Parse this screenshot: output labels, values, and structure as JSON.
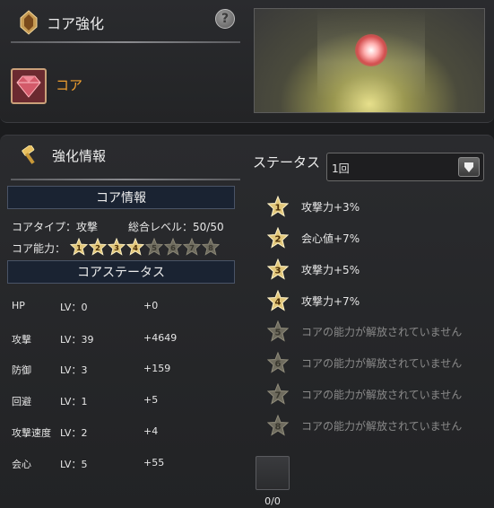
{
  "header": {
    "title": "コア強化",
    "help_symbol": "?",
    "core_label": "コア"
  },
  "enhance": {
    "section_title": "強化情報",
    "core_info_title": "コア情報",
    "core_type": "コアタイプ：攻撃",
    "total_level": "総合レベル：50/50",
    "core_ability_label": "コア能力：",
    "ability_stars": [
      {
        "n": "1",
        "unlocked": true
      },
      {
        "n": "2",
        "unlocked": true
      },
      {
        "n": "3",
        "unlocked": true
      },
      {
        "n": "4",
        "unlocked": true
      },
      {
        "n": "5",
        "unlocked": false
      },
      {
        "n": "6",
        "unlocked": false
      },
      {
        "n": "7",
        "unlocked": false
      },
      {
        "n": "8",
        "unlocked": false
      }
    ],
    "core_status_title": "コアステータス",
    "stats": [
      {
        "name": "HP",
        "lv": "LV：0",
        "bonus": "+0"
      },
      {
        "name": "攻撃",
        "lv": "LV：39",
        "bonus": "+4649"
      },
      {
        "name": "防御",
        "lv": "LV：3",
        "bonus": "+159"
      },
      {
        "name": "回避",
        "lv": "LV：1",
        "bonus": "+5"
      },
      {
        "name": "攻撃速度",
        "lv": "LV：2",
        "bonus": "+4"
      },
      {
        "name": "会心",
        "lv": "LV：5",
        "bonus": "+55"
      }
    ]
  },
  "status": {
    "label": "ステータス",
    "selected": "1回",
    "bonuses": [
      {
        "n": "1",
        "text": "攻撃力+3%",
        "unlocked": true
      },
      {
        "n": "2",
        "text": "会心値+7%",
        "unlocked": true
      },
      {
        "n": "3",
        "text": "攻撃力+5%",
        "unlocked": true
      },
      {
        "n": "4",
        "text": "攻撃力+7%",
        "unlocked": true
      },
      {
        "n": "5",
        "text": "コアの能力が解放されていません",
        "unlocked": false
      },
      {
        "n": "6",
        "text": "コアの能力が解放されていません",
        "unlocked": false
      },
      {
        "n": "7",
        "text": "コアの能力が解放されていません",
        "unlocked": false
      },
      {
        "n": "8",
        "text": "コアの能力が解放されていません",
        "unlocked": false
      }
    ],
    "material_count": "0/0"
  },
  "colors": {
    "accent_orange": "#f0a030",
    "star_gold": "#e2c77a",
    "star_locked": "#6e6b5e"
  }
}
